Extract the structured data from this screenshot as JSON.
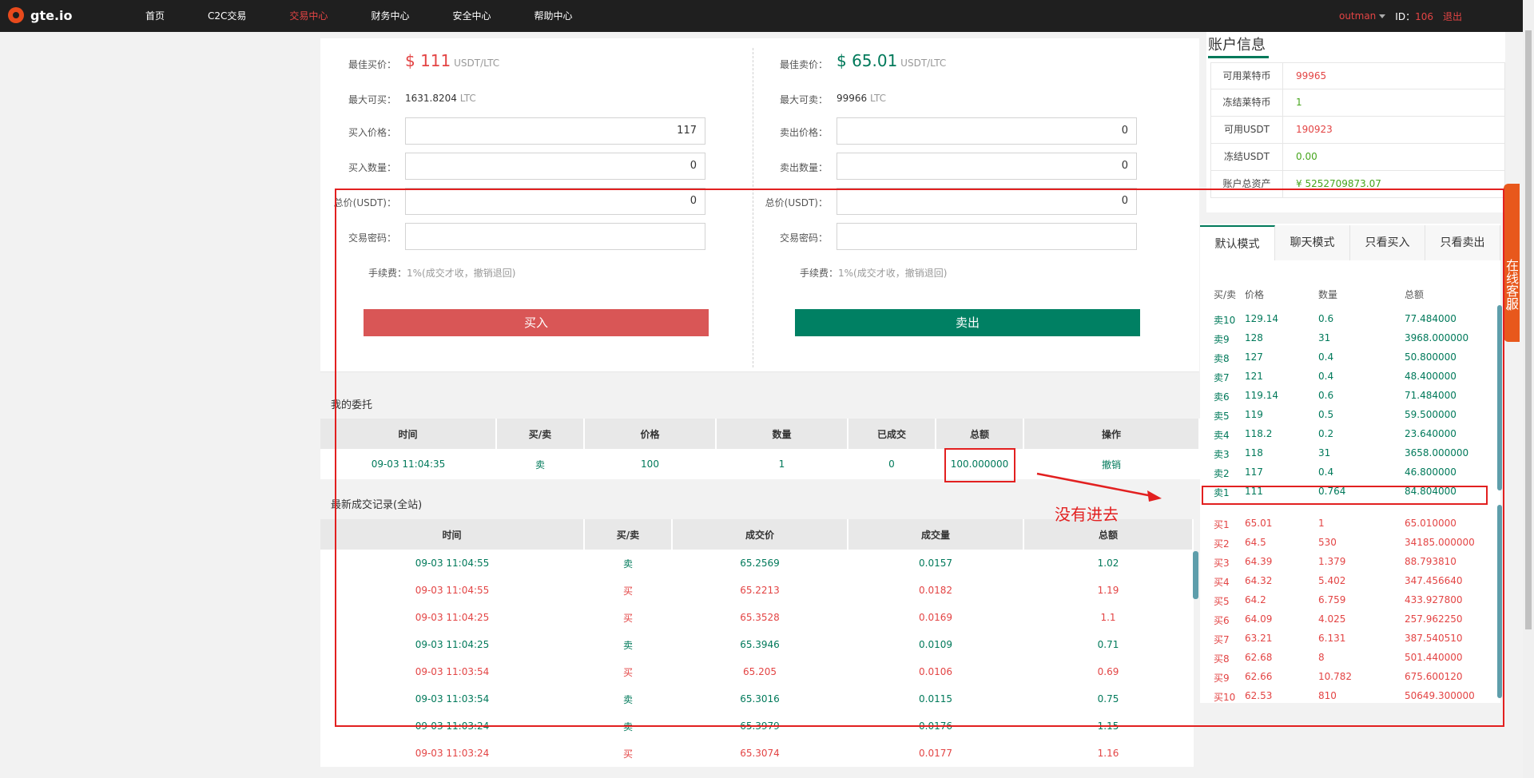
{
  "nav": {
    "logo": "gte.io",
    "items": [
      "首页",
      "C2C交易",
      "交易中心",
      "财务中心",
      "安全中心",
      "帮助中心"
    ],
    "active": "交易中心",
    "user": "outman",
    "id_label": "ID：",
    "id_value": "106",
    "logout": "退出"
  },
  "buy": {
    "best_label": "最佳买价：",
    "best_value": "$ 111",
    "unit": "USDT/LTC",
    "max_label": "最大可买：",
    "max_value": "1631.8204",
    "max_unit": "LTC",
    "price_label": "买入价格：",
    "price_value": "117",
    "qty_label": "买入数量：",
    "qty_value": "0",
    "total_label": "总价(USDT)：",
    "total_value": "0",
    "pwd_label": "交易密码：",
    "pwd_value": "",
    "fee_label": "手续费：",
    "fee_value": "1%(成交才收，撤销退回)",
    "button": "买入"
  },
  "sell": {
    "best_label": "最佳卖价：",
    "best_value": "$ 65.01",
    "unit": "USDT/LTC",
    "max_label": "最大可卖：",
    "max_value": "99966",
    "max_unit": "LTC",
    "price_label": "卖出价格：",
    "price_value": "0",
    "qty_label": "卖出数量：",
    "qty_value": "0",
    "total_label": "总价(USDT)：",
    "total_value": "0",
    "pwd_label": "交易密码：",
    "pwd_value": "",
    "fee_label": "手续费：",
    "fee_value": "1%(成交才收，撤销退回)",
    "button": "卖出"
  },
  "orders": {
    "title": "我的委托",
    "columns": [
      "时间",
      "买/卖",
      "价格",
      "数量",
      "已成交",
      "总额",
      "操作"
    ],
    "rows": [
      [
        "09-03 11:04:35",
        "卖",
        "100",
        "1",
        "0",
        "100.000000",
        "撤销"
      ]
    ]
  },
  "trades": {
    "title": "最新成交记录(全站)",
    "columns": [
      "时间",
      "买/卖",
      "成交价",
      "成交量",
      "总额"
    ],
    "rows": [
      [
        "09-03 11:04:55",
        "卖",
        "65.2569",
        "0.0157",
        "1.02"
      ],
      [
        "09-03 11:04:55",
        "买",
        "65.2213",
        "0.0182",
        "1.19"
      ],
      [
        "09-03 11:04:25",
        "买",
        "65.3528",
        "0.0169",
        "1.1"
      ],
      [
        "09-03 11:04:25",
        "卖",
        "65.3946",
        "0.0109",
        "0.71"
      ],
      [
        "09-03 11:03:54",
        "买",
        "65.205",
        "0.0106",
        "0.69"
      ],
      [
        "09-03 11:03:54",
        "卖",
        "65.3016",
        "0.0115",
        "0.75"
      ],
      [
        "09-03 11:03:24",
        "卖",
        "65.3979",
        "0.0176",
        "1.15"
      ],
      [
        "09-03 11:03:24",
        "买",
        "65.3074",
        "0.0177",
        "1.16"
      ]
    ]
  },
  "account": {
    "title": "账户信息",
    "rows": [
      {
        "label": "可用莱特币",
        "value": "99965",
        "color": "#e34444"
      },
      {
        "label": "冻结莱特币",
        "value": "1",
        "color": "#46a51d"
      },
      {
        "label": "可用USDT",
        "value": "190923",
        "color": "#e34444"
      },
      {
        "label": "冻结USDT",
        "value": "0.00",
        "color": "#46a51d"
      },
      {
        "label": "账户总资产",
        "value": "¥ 5252709873.07",
        "color": "#46a51d"
      }
    ]
  },
  "orderbook": {
    "tabs": [
      "默认模式",
      "聊天模式",
      "只看买入",
      "只看卖出"
    ],
    "active_tab": "默认模式",
    "header": [
      "买/卖",
      "价格",
      "数量",
      "总额"
    ],
    "sells": [
      [
        "卖10",
        "129.14",
        "0.6",
        "77.484000"
      ],
      [
        "卖9",
        "128",
        "31",
        "3968.000000"
      ],
      [
        "卖8",
        "127",
        "0.4",
        "50.800000"
      ],
      [
        "卖7",
        "121",
        "0.4",
        "48.400000"
      ],
      [
        "卖6",
        "119.14",
        "0.6",
        "71.484000"
      ],
      [
        "卖5",
        "119",
        "0.5",
        "59.500000"
      ],
      [
        "卖4",
        "118.2",
        "0.2",
        "23.640000"
      ],
      [
        "卖3",
        "118",
        "31",
        "3658.000000"
      ],
      [
        "卖2",
        "117",
        "0.4",
        "46.800000"
      ],
      [
        "卖1",
        "111",
        "0.764",
        "84.804000"
      ]
    ],
    "buys": [
      [
        "买1",
        "65.01",
        "1",
        "65.010000"
      ],
      [
        "买2",
        "64.5",
        "530",
        "34185.000000"
      ],
      [
        "买3",
        "64.39",
        "1.379",
        "88.793810"
      ],
      [
        "买4",
        "64.32",
        "5.402",
        "347.456640"
      ],
      [
        "买5",
        "64.2",
        "6.759",
        "433.927800"
      ],
      [
        "买6",
        "64.09",
        "4.025",
        "257.962250"
      ],
      [
        "买7",
        "63.21",
        "6.131",
        "387.540510"
      ],
      [
        "买8",
        "62.68",
        "8",
        "501.440000"
      ],
      [
        "买9",
        "62.66",
        "10.782",
        "675.600120"
      ],
      [
        "买10",
        "62.53",
        "810",
        "50649.300000"
      ]
    ]
  },
  "service": {
    "label": "在线客服",
    "icon": "double-chevron-left-icon"
  },
  "annotation": {
    "text": "没有进去",
    "color": "#e22020"
  }
}
